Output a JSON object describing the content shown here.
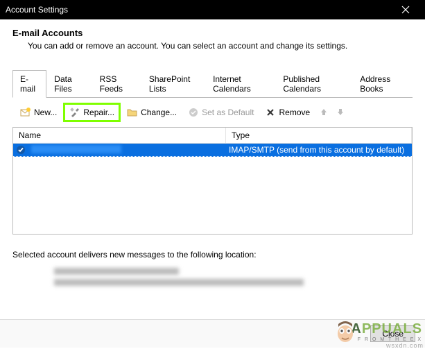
{
  "window": {
    "title": "Account Settings"
  },
  "header": {
    "title": "E-mail Accounts",
    "subtitle": "You can add or remove an account. You can select an account and change its settings."
  },
  "tabs": [
    {
      "label": "E-mail",
      "active": true
    },
    {
      "label": "Data Files",
      "active": false
    },
    {
      "label": "RSS Feeds",
      "active": false
    },
    {
      "label": "SharePoint Lists",
      "active": false
    },
    {
      "label": "Internet Calendars",
      "active": false
    },
    {
      "label": "Published Calendars",
      "active": false
    },
    {
      "label": "Address Books",
      "active": false
    }
  ],
  "toolbar": {
    "new_label": "New...",
    "repair_label": "Repair...",
    "change_label": "Change...",
    "set_default_label": "Set as Default",
    "remove_label": "Remove"
  },
  "grid": {
    "columns": {
      "name": "Name",
      "type": "Type"
    },
    "rows": [
      {
        "name_redacted": true,
        "type": "IMAP/SMTP (send from this account by default)"
      }
    ]
  },
  "delivery": {
    "text": "Selected account delivers new messages to the following location:"
  },
  "footer": {
    "close_label": "Close"
  },
  "watermark": {
    "brand": "APPUALS",
    "tag": "F R O M   T H E   E X",
    "site": "wsxdn.com"
  }
}
